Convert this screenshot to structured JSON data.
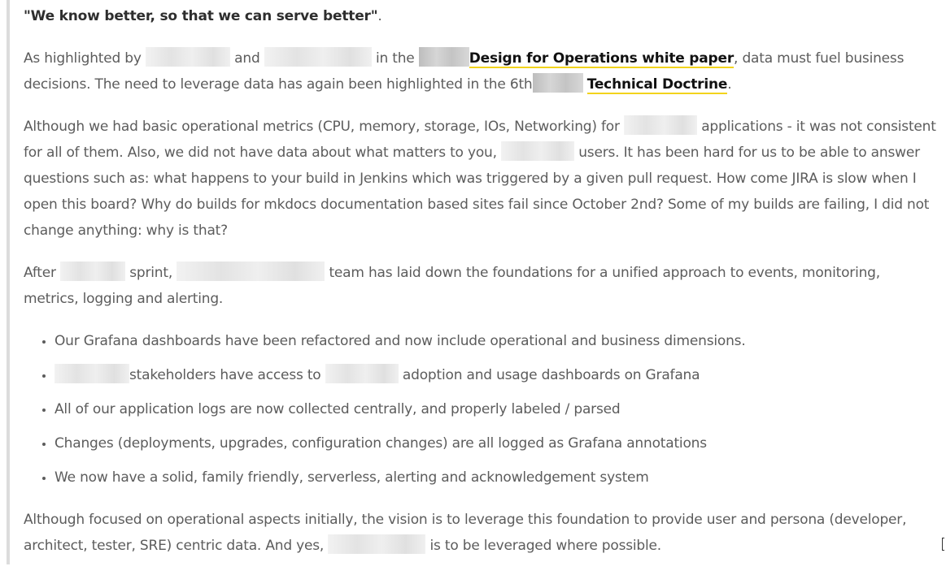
{
  "lead_quote": "\"We know better, so that we can serve better\"",
  "lead_period": ".",
  "p1": {
    "t1": "As highlighted by ",
    "t2": " and ",
    "t3": " in the ",
    "link1": "Design for Operations white paper",
    "t4": ", data must fuel business decisions. The need to leverage data has again been highlighted in the 6th",
    "link2": "Technical Doctrine",
    "t5": "."
  },
  "p2": {
    "t1": "Although we had basic operational metrics (CPU, memory, storage, IOs, Networking) for ",
    "t2": " applications - it was not consistent for all of them. Also, we did not have data about what matters to you, ",
    "t3": " users. It has been hard for us to be able to answer questions such as: what happens to your build in Jenkins which was triggered by a given pull request. How come JIRA is slow when I open this board? Why do builds for mkdocs documentation based sites fail since October 2nd? Some of my builds are failing, I did not change anything: why is that?"
  },
  "p3": {
    "t1": "After ",
    "t2": " sprint, ",
    "t3": " team has laid down the foundations for a unified approach to events, monitoring, metrics, logging and alerting."
  },
  "bullets": {
    "b1": "Our Grafana dashboards have been refactored and now include operational and business dimensions.",
    "b2_a": "stakeholders have access to ",
    "b2_b": " adoption and usage dashboards on Grafana",
    "b3": "All of our application logs are now collected centrally, and properly labeled / parsed",
    "b4": "Changes (deployments, upgrades, configuration changes) are all logged as Grafana annotations",
    "b5": "We now have a solid, family friendly, serverless, alerting and acknowledgement system"
  },
  "p4": {
    "t1": "Although focused on operational aspects initially, the vision is to leverage this foundation to provide user and persona (developer, architect, tester, SRE) centric data. And yes, ",
    "t2": " is to be leveraged where possible."
  }
}
